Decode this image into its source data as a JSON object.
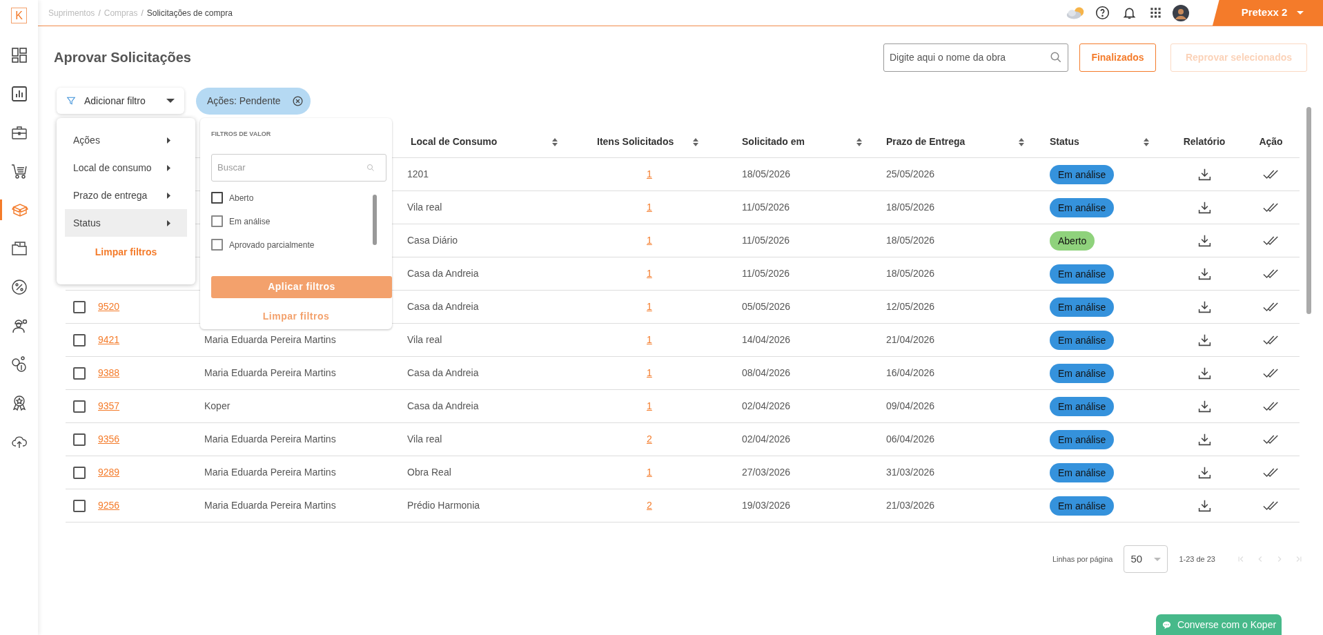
{
  "sidebar": {
    "logo": "K",
    "items": [
      {
        "selected": false
      },
      {
        "selected": false
      },
      {
        "selected": false
      },
      {
        "selected": false
      },
      {
        "selected": true
      },
      {
        "selected": false
      },
      {
        "selected": false
      },
      {
        "selected": false
      },
      {
        "selected": false
      },
      {
        "selected": false
      },
      {
        "selected": false
      }
    ]
  },
  "breadcrumb": [
    {
      "label": "Suprimentos",
      "current": false,
      "separator": "/"
    },
    {
      "label": "Compras",
      "current": false,
      "separator": "/"
    },
    {
      "label": "Solicitações de compra",
      "current": true
    }
  ],
  "account": {
    "label": "Pretexx 2"
  },
  "page": {
    "title": "Aprovar Solicitações",
    "search_placeholder": "Digite aqui o nome da obra",
    "buttons": [
      {
        "label": "Finalizados",
        "disabled": false
      },
      {
        "label": "Reprovar selecionados",
        "disabled": true
      }
    ]
  },
  "filters": {
    "button": "Adicionar filtro",
    "chips": [
      {
        "label": "Ações: Pendente"
      }
    ],
    "menu": {
      "items": [
        {
          "label": "Ações",
          "selected": false
        },
        {
          "label": "Local de consumo",
          "selected": false
        },
        {
          "label": "Prazo de entrega",
          "selected": false
        },
        {
          "label": "Status",
          "selected": true
        }
      ],
      "clear": "Limpar filtros"
    },
    "values_panel": {
      "heading": "FILTROS DE VALOR",
      "search_placeholder": "Buscar",
      "options": [
        {
          "label": "Aberto",
          "checked": false
        },
        {
          "label": "Em análise",
          "checked": false
        },
        {
          "label": "Aprovado parcialmente",
          "checked": false
        }
      ],
      "apply": {
        "label": "Aplicar filtros",
        "disabled": true
      },
      "clear": {
        "label": "Limpar filtros",
        "disabled": true
      }
    }
  },
  "table": {
    "columns": [
      {
        "label": "Local de Consumo",
        "sortable": true
      },
      {
        "label": "Itens Solicitados",
        "sortable": true
      },
      {
        "label": "Solicitado em",
        "sortable": true
      },
      {
        "label": "Prazo de Entrega",
        "sortable": true
      },
      {
        "label": "Status",
        "sortable": true
      },
      {
        "label": "Relatório",
        "sortable": false
      },
      {
        "label": "Ação",
        "sortable": false
      }
    ],
    "rows": [
      {
        "location": "1201",
        "items": "1",
        "requested_on": "18/05/2026",
        "due": "25/05/2026",
        "status": {
          "label": "Em análise",
          "color": "#3592dc"
        }
      },
      {
        "location": "Vila real",
        "items": "1",
        "requested_on": "11/05/2026",
        "due": "18/05/2026",
        "status": {
          "label": "Em análise",
          "color": "#3592dc"
        }
      },
      {
        "location": "Casa Diário",
        "items": "1",
        "requested_on": "11/05/2026",
        "due": "18/05/2026",
        "status": {
          "label": "Aberto",
          "color": "#8fd27c"
        }
      },
      {
        "location": "Casa da Andreia",
        "items": "1",
        "requested_on": "11/05/2026",
        "due": "18/05/2026",
        "status": {
          "label": "Em análise",
          "color": "#3592dc"
        }
      },
      {
        "checked": false,
        "id": "9520",
        "location": "Casa da Andreia",
        "items": "1",
        "requested_on": "05/05/2026",
        "due": "12/05/2026",
        "status": {
          "label": "Em análise",
          "color": "#3592dc"
        }
      },
      {
        "checked": false,
        "id": "9421",
        "requester": "Maria Eduarda Pereira Martins",
        "location": "Vila real",
        "items": "1",
        "requested_on": "14/04/2026",
        "due": "21/04/2026",
        "status": {
          "label": "Em análise",
          "color": "#3592dc"
        }
      },
      {
        "checked": false,
        "id": "9388",
        "requester": "Maria Eduarda Pereira Martins",
        "location": "Casa da Andreia",
        "items": "1",
        "requested_on": "08/04/2026",
        "due": "16/04/2026",
        "status": {
          "label": "Em análise",
          "color": "#3592dc"
        }
      },
      {
        "checked": false,
        "id": "9357",
        "requester": "Koper",
        "location": "Casa da Andreia",
        "items": "1",
        "requested_on": "02/04/2026",
        "due": "09/04/2026",
        "status": {
          "label": "Em análise",
          "color": "#3592dc"
        }
      },
      {
        "checked": false,
        "id": "9356",
        "requester": "Maria Eduarda Pereira Martins",
        "location": "Vila real",
        "items": "2",
        "requested_on": "02/04/2026",
        "due": "06/04/2026",
        "status": {
          "label": "Em análise",
          "color": "#3592dc"
        }
      },
      {
        "checked": false,
        "id": "9289",
        "requester": "Maria Eduarda Pereira Martins",
        "location": "Obra Real",
        "items": "1",
        "requested_on": "27/03/2026",
        "due": "31/03/2026",
        "status": {
          "label": "Em análise",
          "color": "#3592dc"
        }
      },
      {
        "checked": false,
        "id": "9256",
        "requester": "Maria Eduarda Pereira Martins",
        "location": "Prédio Harmonia",
        "items": "2",
        "requested_on": "19/03/2026",
        "due": "21/03/2026",
        "status": {
          "label": "Em análise",
          "color": "#3592dc"
        }
      }
    ]
  },
  "pagination": {
    "rows_label": "Linhas por página",
    "rows_per_page": "50",
    "range": "1-23 de 23"
  },
  "chat": {
    "label": "Converse com o Koper"
  }
}
